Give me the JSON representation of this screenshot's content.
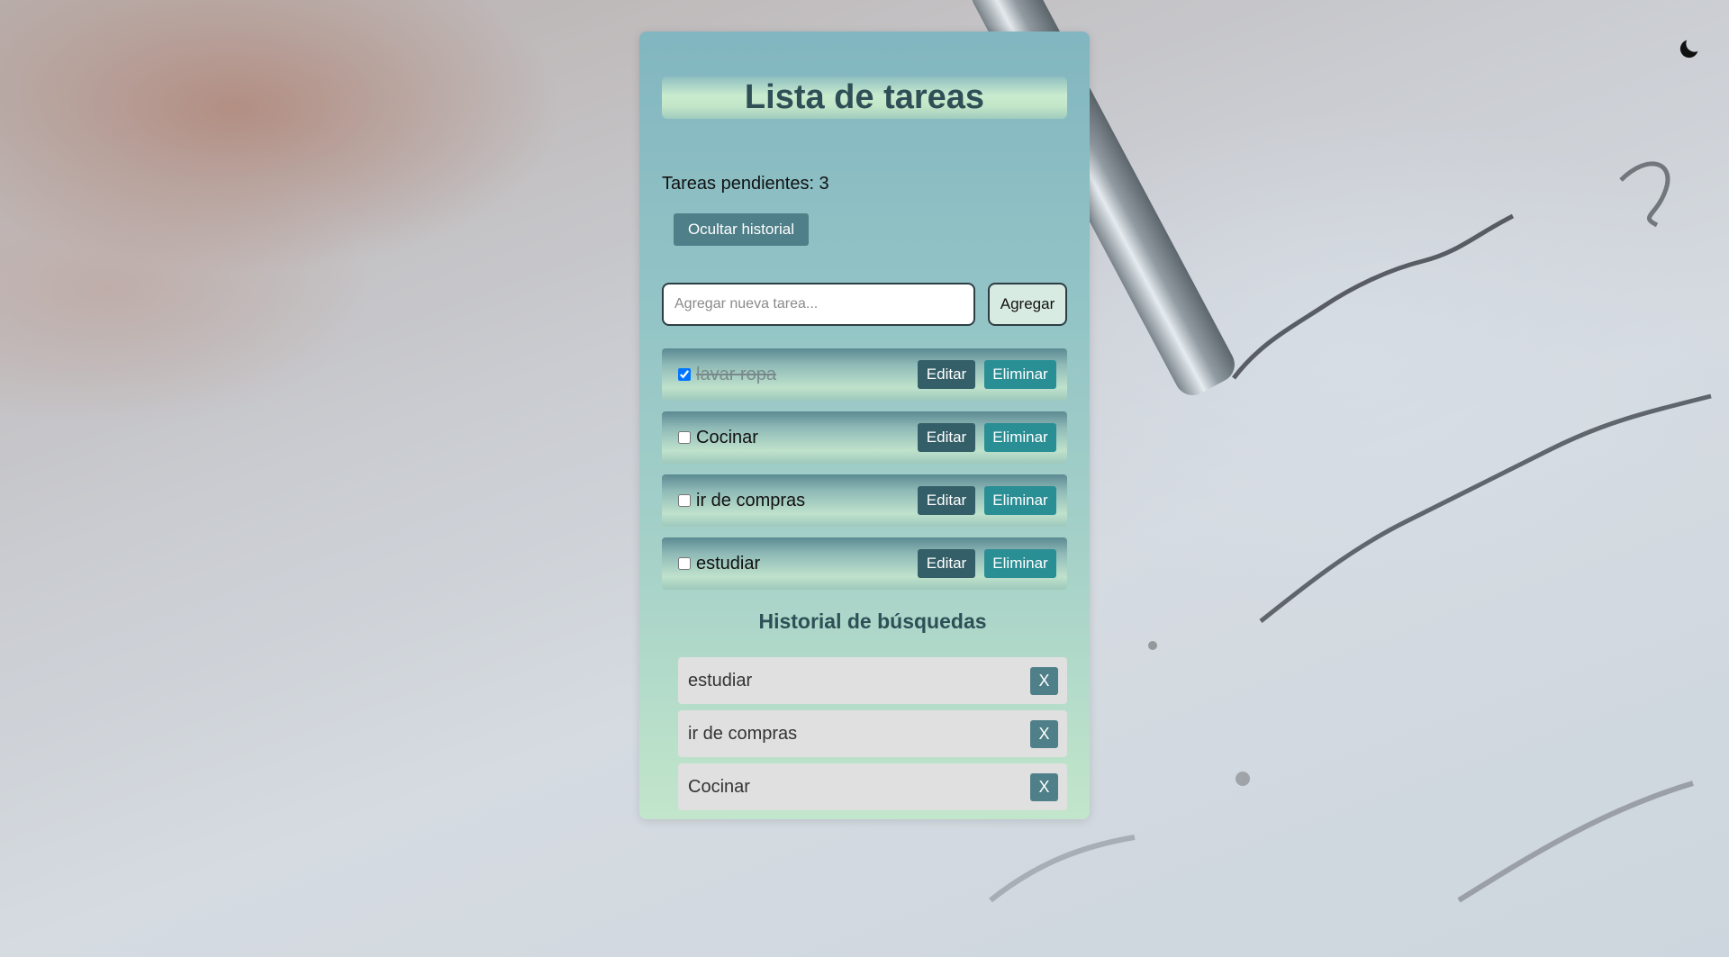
{
  "title": "Lista de tareas",
  "pending_label": "Tareas pendientes: 3",
  "history_toggle_label": "Ocultar historial",
  "input": {
    "placeholder": "Agregar nueva tarea...",
    "value": ""
  },
  "add_label": "Agregar",
  "tasks": [
    {
      "text": "lavar ropa",
      "done": true,
      "edit_label": "Editar",
      "delete_label": "Eliminar"
    },
    {
      "text": "Cocinar",
      "done": false,
      "edit_label": "Editar",
      "delete_label": "Eliminar"
    },
    {
      "text": "ir de compras",
      "done": false,
      "edit_label": "Editar",
      "delete_label": "Eliminar"
    },
    {
      "text": "estudiar",
      "done": false,
      "edit_label": "Editar",
      "delete_label": "Eliminar"
    }
  ],
  "history": {
    "title": "Historial de búsquedas",
    "items": [
      {
        "text": "estudiar",
        "remove_label": "X"
      },
      {
        "text": "ir de compras",
        "remove_label": "X"
      },
      {
        "text": "Cocinar",
        "remove_label": "X"
      }
    ]
  },
  "icons": {
    "theme_toggle": "moon-icon",
    "checkbox": "checkbox"
  },
  "colors": {
    "title": "#2f4f57",
    "edit_button": "#355f68",
    "delete_button": "#2a8e95",
    "history_button": "#4f7f88"
  }
}
